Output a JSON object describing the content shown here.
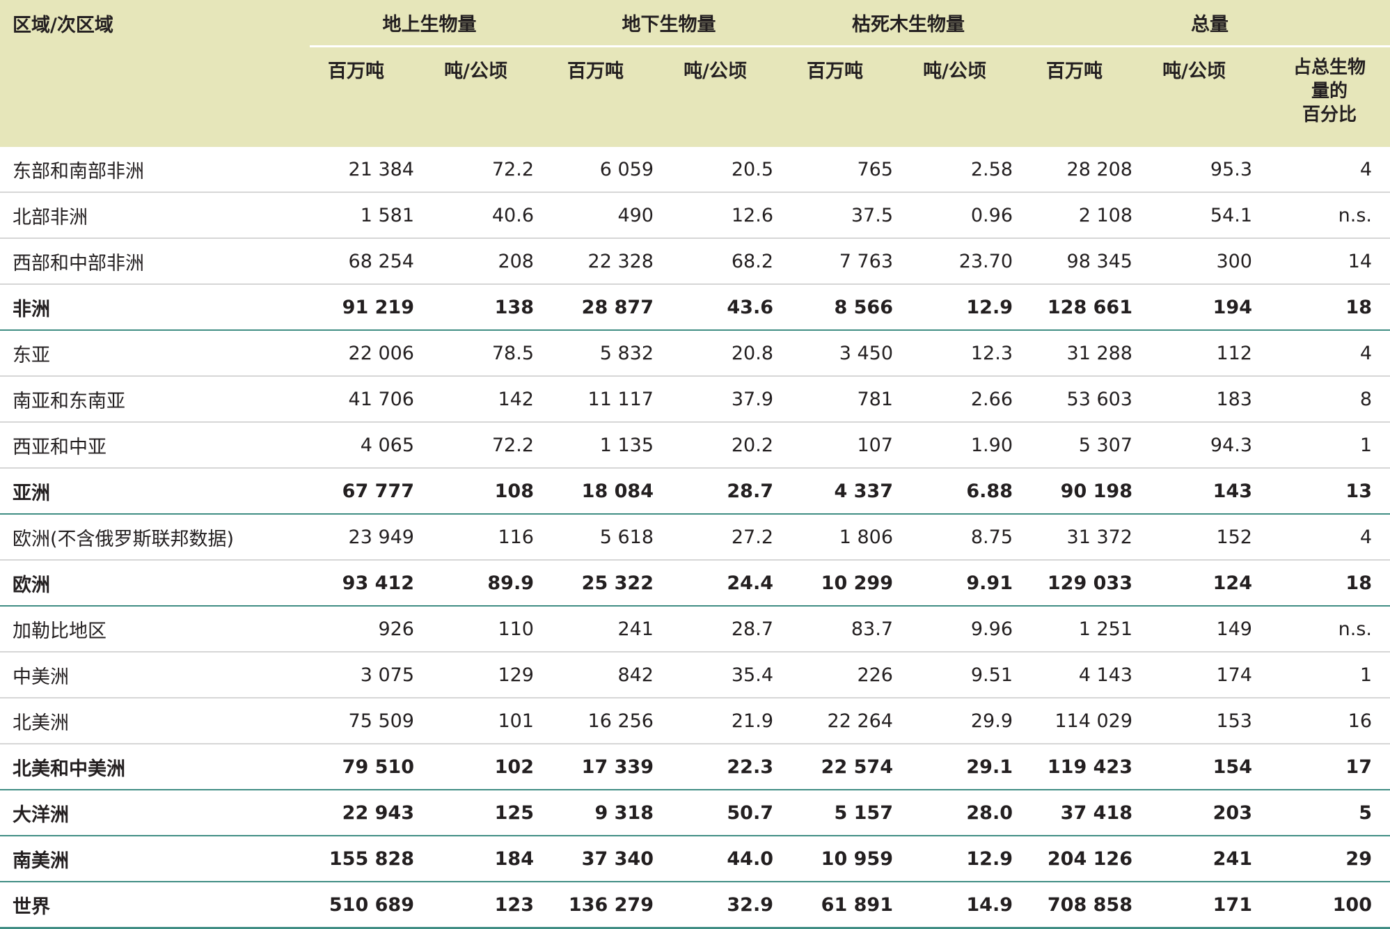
{
  "header": {
    "region": "区域/次区域",
    "groups": [
      "地上生物量",
      "地下生物量",
      "枯死木生物量",
      "总量"
    ],
    "units": {
      "mt": "百万吨",
      "tha": "吨/公顷",
      "pct": [
        "占总生物",
        "量的",
        "百分比"
      ]
    }
  },
  "rows": [
    {
      "name": "东部和南部非洲",
      "total": false,
      "cells": [
        "21 384",
        "72.2",
        "6 059",
        "20.5",
        "765",
        "2.58",
        "28 208",
        "95.3",
        "4"
      ]
    },
    {
      "name": "北部非洲",
      "total": false,
      "cells": [
        "1 581",
        "40.6",
        "490",
        "12.6",
        "37.5",
        "0.96",
        "2 108",
        "54.1",
        "n.s."
      ]
    },
    {
      "name": "西部和中部非洲",
      "total": false,
      "cells": [
        "68 254",
        "208",
        "22 328",
        "68.2",
        "7 763",
        "23.70",
        "98 345",
        "300",
        "14"
      ]
    },
    {
      "name": "非洲",
      "total": true,
      "cells": [
        "91 219",
        "138",
        "28 877",
        "43.6",
        "8 566",
        "12.9",
        "128 661",
        "194",
        "18"
      ]
    },
    {
      "name": "东亚",
      "total": false,
      "cells": [
        "22 006",
        "78.5",
        "5 832",
        "20.8",
        "3 450",
        "12.3",
        "31 288",
        "112",
        "4"
      ]
    },
    {
      "name": "南亚和东南亚",
      "total": false,
      "cells": [
        "41 706",
        "142",
        "11 117",
        "37.9",
        "781",
        "2.66",
        "53 603",
        "183",
        "8"
      ]
    },
    {
      "name": "西亚和中亚",
      "total": false,
      "cells": [
        "4 065",
        "72.2",
        "1 135",
        "20.2",
        "107",
        "1.90",
        "5 307",
        "94.3",
        "1"
      ]
    },
    {
      "name": "亚洲",
      "total": true,
      "cells": [
        "67 777",
        "108",
        "18 084",
        "28.7",
        "4 337",
        "6.88",
        "90 198",
        "143",
        "13"
      ]
    },
    {
      "name": "欧洲(不含俄罗斯联邦数据)",
      "total": false,
      "cells": [
        "23 949",
        "116",
        "5 618",
        "27.2",
        "1 806",
        "8.75",
        "31 372",
        "152",
        "4"
      ]
    },
    {
      "name": "欧洲",
      "total": true,
      "cells": [
        "93 412",
        "89.9",
        "25 322",
        "24.4",
        "10 299",
        "9.91",
        "129 033",
        "124",
        "18"
      ]
    },
    {
      "name": "加勒比地区",
      "total": false,
      "cells": [
        "926",
        "110",
        "241",
        "28.7",
        "83.7",
        "9.96",
        "1 251",
        "149",
        "n.s."
      ]
    },
    {
      "name": "中美洲",
      "total": false,
      "cells": [
        "3 075",
        "129",
        "842",
        "35.4",
        "226",
        "9.51",
        "4 143",
        "174",
        "1"
      ]
    },
    {
      "name": "北美洲",
      "total": false,
      "cells": [
        "75 509",
        "101",
        "16 256",
        "21.9",
        "22 264",
        "29.9",
        "114 029",
        "153",
        "16"
      ]
    },
    {
      "name": "北美和中美洲",
      "total": true,
      "cells": [
        "79 510",
        "102",
        "17 339",
        "22.3",
        "22 574",
        "29.1",
        "119 423",
        "154",
        "17"
      ]
    },
    {
      "name": "大洋洲",
      "total": true,
      "cells": [
        "22 943",
        "125",
        "9 318",
        "50.7",
        "5 157",
        "28.0",
        "37 418",
        "203",
        "5"
      ]
    },
    {
      "name": "南美洲",
      "total": true,
      "cells": [
        "155 828",
        "184",
        "37 340",
        "44.0",
        "10 959",
        "12.9",
        "204 126",
        "241",
        "29"
      ]
    },
    {
      "name": "世界",
      "total": true,
      "world": true,
      "cells": [
        "510 689",
        "123",
        "136 279",
        "32.9",
        "61 891",
        "14.9",
        "708 858",
        "171",
        "100"
      ]
    }
  ]
}
